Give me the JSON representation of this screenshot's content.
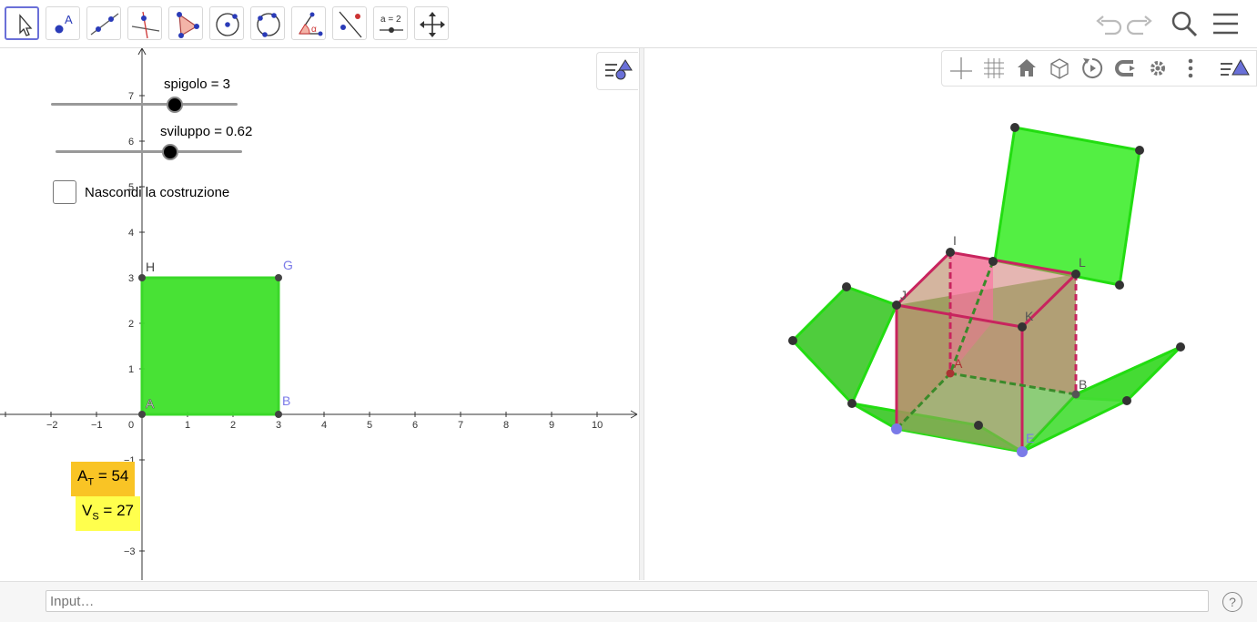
{
  "toolbar": {
    "tools": [
      {
        "name": "move-tool",
        "icon": "arrow-cursor-icon",
        "active": true
      },
      {
        "name": "point-tool",
        "icon": "point-icon",
        "label": "A"
      },
      {
        "name": "line-tool",
        "icon": "line-through-points-icon"
      },
      {
        "name": "perpendicular-line-tool",
        "icon": "perpendicular-line-icon"
      },
      {
        "name": "polygon-tool",
        "icon": "polygon-icon"
      },
      {
        "name": "circle-tool",
        "icon": "circle-center-point-icon"
      },
      {
        "name": "circle-three-points-tool",
        "icon": "circle-three-points-icon"
      },
      {
        "name": "angle-tool",
        "icon": "angle-icon",
        "label": "α"
      },
      {
        "name": "reflect-tool",
        "icon": "reflect-about-line-icon"
      },
      {
        "name": "slider-tool",
        "icon": "slider-icon",
        "label": "a = 2"
      },
      {
        "name": "move-graphics-tool",
        "icon": "move-graphics-icon"
      }
    ],
    "right": [
      "undo-icon",
      "redo-icon",
      "search-icon",
      "menu-icon"
    ]
  },
  "graphics2d": {
    "sliders": [
      {
        "name": "spigolo",
        "label": "spigolo = 3",
        "value": 3,
        "min": 0,
        "max": 5
      },
      {
        "name": "sviluppo",
        "label": "sviluppo = 0.62",
        "value": 0.62,
        "min": 0,
        "max": 1.2
      }
    ],
    "checkbox": {
      "label": "Nascondi la costruzione",
      "checked": false
    },
    "x_ticks": [
      "−2",
      "−1",
      "0",
      "1",
      "2",
      "3",
      "4",
      "5",
      "6",
      "7",
      "8",
      "9",
      "10"
    ],
    "y_ticks": [
      "7",
      "6",
      "5",
      "4",
      "3",
      "2",
      "1",
      "−1",
      "−3"
    ],
    "points": {
      "A": "A",
      "B": "B",
      "G": "G",
      "H": "H"
    },
    "square_color": "#3ee02a",
    "area_label": {
      "text": "A",
      "sub": "T",
      "value": "= 54",
      "bg": "#f9c425"
    },
    "volume_label": {
      "text": "V",
      "sub": "S",
      "value": "= 27",
      "bg": "#ffff4d"
    }
  },
  "graphics3d": {
    "toolbar": [
      "axes-icon",
      "grid-icon",
      "home-icon",
      "cube-view-icon",
      "rotate-icon",
      "projection-icon",
      "settings-icon",
      "more-vert-icon",
      "style-bar-toggle-icon"
    ],
    "point_labels": {
      "I": "I",
      "L": "L",
      "J": "J",
      "K": "K",
      "A": "A",
      "B": "B",
      "E": "E"
    },
    "face_color": "#44ee33",
    "cube_edge_color": "#c8245e"
  },
  "inputbar": {
    "placeholder": "Input…",
    "help": "?"
  }
}
